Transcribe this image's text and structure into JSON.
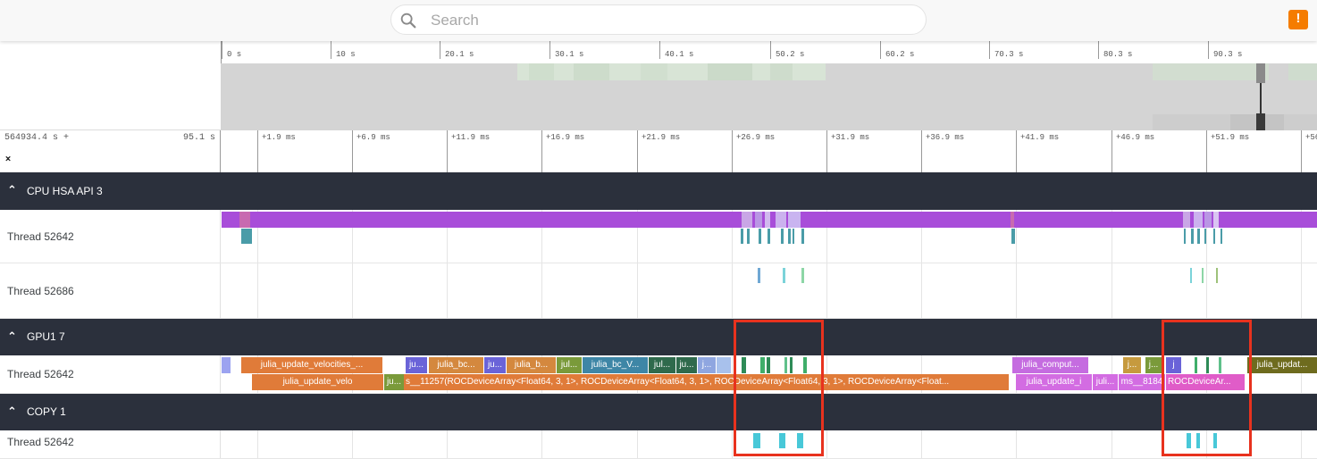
{
  "search": {
    "placeholder": "Search"
  },
  "alert": {
    "label": "!"
  },
  "overview": {
    "labels": [
      "0 s",
      "10 s",
      "20.1 s",
      "30.1 s",
      "40.1 s",
      "50.2 s",
      "60.2 s",
      "70.3 s",
      "80.3 s",
      "90.3 s"
    ]
  },
  "timeaxis": {
    "offset": "564934.4 s +",
    "span": "95.1 s",
    "labels": [
      "+1.9 ms",
      "+6.9 ms",
      "+11.9 ms",
      "+16.9 ms",
      "+21.9 ms",
      "+26.9 ms",
      "+31.9 ms",
      "+36.9 ms",
      "+41.9 ms",
      "+46.9 ms",
      "+51.9 ms",
      "+56"
    ]
  },
  "groups": {
    "cpu": {
      "title": "CPU HSA API 3"
    },
    "gpu": {
      "title": "GPU1 7"
    },
    "copy": {
      "title": "COPY 1"
    }
  },
  "tracks": {
    "cpu_t1": "Thread 52642",
    "cpu_t2": "Thread 52686",
    "gpu_t1": "Thread 52642",
    "copy_t1": "Thread 52642"
  },
  "gpu_slices": {
    "row1": [
      "julia_update_velocities_...",
      "ju...",
      "julia_bc...",
      "ju...",
      "julia_b...",
      "jul...",
      "julia_bc_V...",
      "jul...",
      "ju...",
      "j...",
      "julia_comput...",
      "j...",
      "j...",
      "j",
      "julia_updat..."
    ],
    "row2": [
      "julia_update_velo",
      "ju...",
      "s__11257(ROCDeviceArray<Float64, 3, 1>, ROCDeviceArray<Float64, 3, 1>, ROCDeviceArray<Float64, 3, 1>, ROCDeviceArray<Float...",
      "julia_update_i",
      "juli...",
      "ms__8184",
      "ROCDeviceAr..."
    ]
  },
  "colors": {
    "cpu_bar": "#a84dd9",
    "highlight": "#e8321e",
    "group_header": "#2b303c"
  }
}
